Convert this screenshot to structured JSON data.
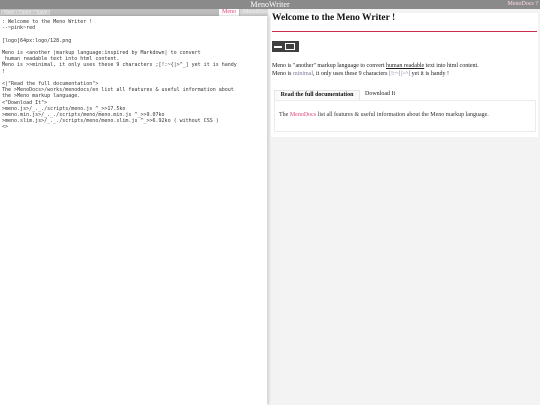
{
  "titlebar": {
    "title": "MenoWriter",
    "docs_link": "MenoDocs ?"
  },
  "toolbar": {
    "buttons": [
      "New",
      "Open",
      "Save"
    ],
    "tab_meno": "Meno",
    "tab_docs": "MenoDocs"
  },
  "editor": {
    "source": ": Welcome to the Meno Writer !\n--~pink~red\n\n[logo]64px:logo/128.png\n\nMeno is <another |markup language:inspired by Markdown| to convert\n_human readable text into html content.\nMeno is >>minimal, it only uses these 9 characters ;[!:~{|>^_] yet it is handy\n!\n\n<|\"Read the full documentation\">\nThe >MenoDocs>/works/menodocs/en list all features & useful information about\nthe >Meno markup language.\n<\"Download It\">\n>meno.js>/_._./scripts/meno.js ^_>>17.5ko\n>meno.min.js>/_._./scripts/meno/meno.min.js ^_>>9.07ko\n>meno.slim.js>/_._./scripts/meno/meno.slim.js ^_>>6.92ko ( without CSS )\n<>"
  },
  "preview": {
    "title": "Welcome to the Meno Writer !",
    "intro": {
      "part1": "Meno is \"another\" markup language to convert ",
      "underline": "human readable",
      "part2": " text into html content.",
      "line2_part1": "Meno is ",
      "minimal": "minimal",
      "line2_part2": ", it only uses these 9 characters ",
      "chars": "[!:~{|>^]",
      "line2_part3": " yet it is handy !"
    },
    "tabs": [
      "Read the full documentation",
      "Download It"
    ],
    "panel": {
      "prefix": "The ",
      "link": "MenoDocs",
      "suffix": " list all features & useful information about the Meno markup language."
    }
  },
  "colors": {
    "accent": "#e2427e",
    "rule": "#cc2a4f",
    "titlebar": "#8a8a8a"
  }
}
